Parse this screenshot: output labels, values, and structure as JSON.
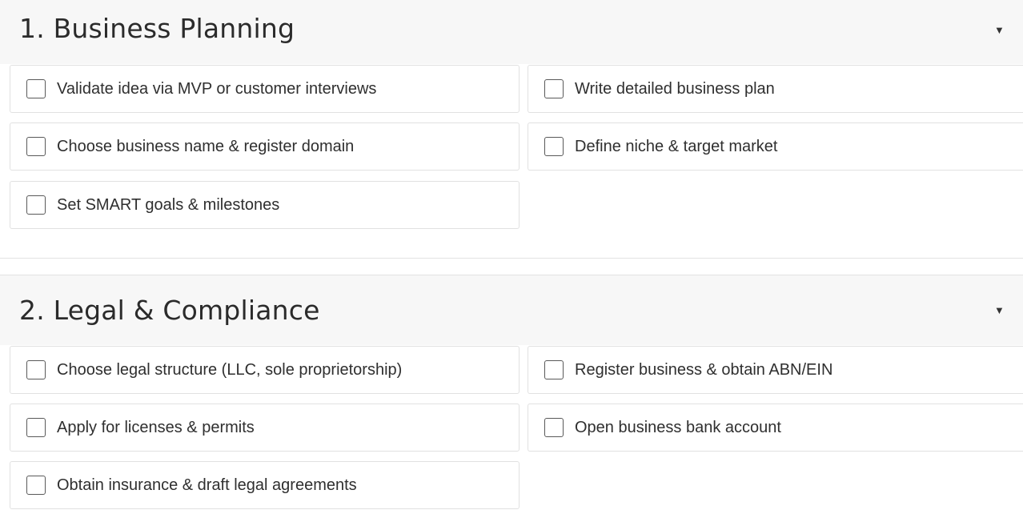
{
  "sections": [
    {
      "title": "1. Business Planning",
      "toggle_glyph": "▼",
      "items": [
        {
          "label": "Validate idea via MVP or customer interviews",
          "checked": false
        },
        {
          "label": "Write detailed business plan",
          "checked": false
        },
        {
          "label": "Choose business name & register domain",
          "checked": false
        },
        {
          "label": "Define niche & target market",
          "checked": false
        },
        {
          "label": "Set SMART goals & milestones",
          "checked": false
        }
      ]
    },
    {
      "title": "2. Legal & Compliance",
      "toggle_glyph": "▼",
      "items": [
        {
          "label": "Choose legal structure (LLC, sole proprietorship)",
          "checked": false
        },
        {
          "label": "Register business & obtain ABN/EIN",
          "checked": false
        },
        {
          "label": "Apply for licenses & permits",
          "checked": false
        },
        {
          "label": "Open business bank account",
          "checked": false
        },
        {
          "label": "Obtain insurance & draft legal agreements",
          "checked": false
        }
      ]
    }
  ]
}
